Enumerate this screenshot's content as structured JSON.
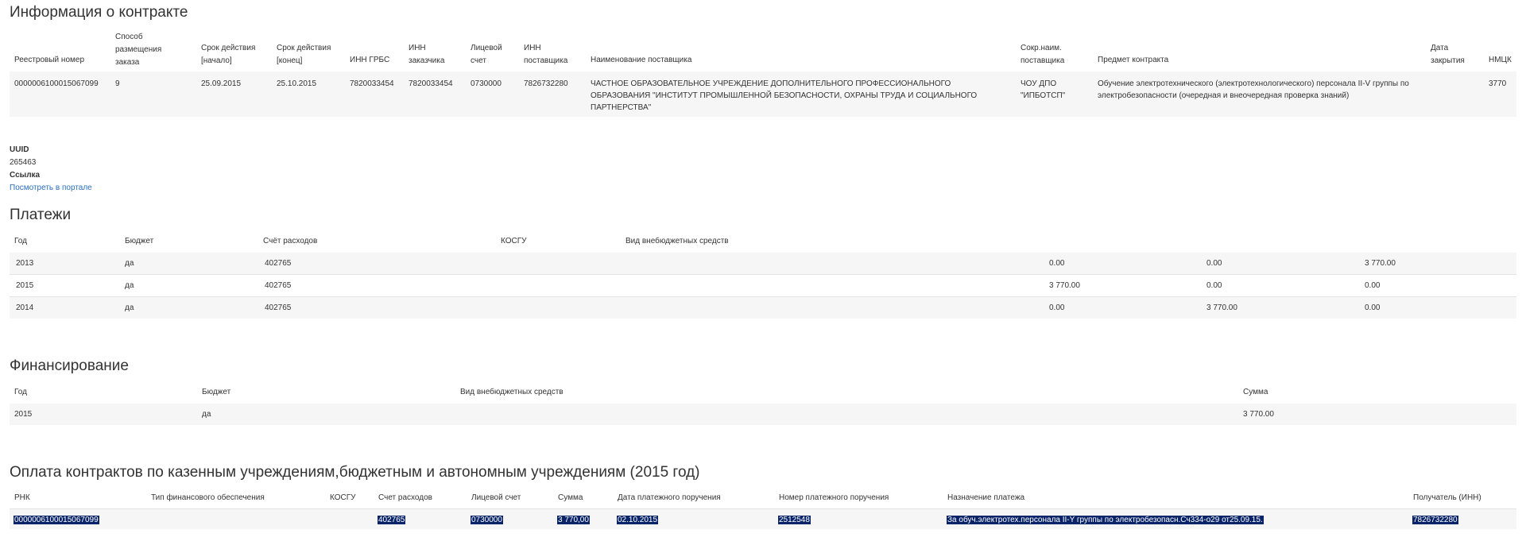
{
  "contract": {
    "title": "Информация о контракте",
    "headers": [
      "Реестровый номер",
      "Способ размещения заказа",
      "Срок действия [начало]",
      "Срок действия [конец]",
      "ИНН ГРБС",
      "ИНН заказчика",
      "Лицевой счет",
      "ИНН поставщика",
      "Наименование поставщика",
      "Сокр.наим. поставщика",
      "Предмет контракта",
      "Дата закрытия",
      "НМЦК"
    ],
    "row": [
      "0000006100015067099",
      "9",
      "25.09.2015",
      "25.10.2015",
      "7820033454",
      "7820033454",
      "0730000",
      "7826732280",
      "ЧАСТНОЕ ОБРАЗОВАТЕЛЬНОЕ УЧРЕЖДЕНИЕ ДОПОЛНИТЕЛЬНОГО ПРОФЕССИОНАЛЬНОГО ОБРАЗОВАНИЯ \"ИНСТИТУТ ПРОМЫШЛЕННОЙ БЕЗОПАСНОСТИ, ОХРАНЫ ТРУДА И СОЦИАЛЬНОГО ПАРТНЕРСТВА\"",
      "ЧОУ ДПО \"ИПБОТСП\"",
      "Обучение электротехнического (электротехнологического) персонала II-V группы по электробезопасности (очередная и внеочередная проверка знаний)",
      "",
      "3770"
    ]
  },
  "meta": {
    "uuid_label": "UUID",
    "uuid_value": "265463",
    "link_label": "Ссылка",
    "link_text": "Посмотреть в портале"
  },
  "payments": {
    "title": "Платежи",
    "headers": [
      "Год",
      "Бюджет",
      "Счёт расходов",
      "КОСГУ",
      "Вид внебюджетных средств"
    ],
    "rows": [
      [
        "2013",
        "да",
        "402765",
        "",
        "",
        "0.00",
        "0.00",
        "3 770.00"
      ],
      [
        "2015",
        "да",
        "402765",
        "",
        "",
        "3 770.00",
        "0.00",
        "0.00"
      ],
      [
        "2014",
        "да",
        "402765",
        "",
        "",
        "0.00",
        "3 770.00",
        "0.00"
      ]
    ]
  },
  "financing": {
    "title": "Финансирование",
    "headers": [
      "Год",
      "Бюджет",
      "Вид внебюджетных средств",
      "Сумма"
    ],
    "row": [
      "2015",
      "да",
      "",
      "3 770.00"
    ]
  },
  "contract_payments": {
    "title": "Оплата контрактов по казенным учреждениям,бюджетным и автономным учреждениям (2015 год)",
    "headers": [
      "РНК",
      "Тип финансового обеспечения",
      "КОСГУ",
      "Счет расходов",
      "Лицевой счет",
      "Сумма",
      "Дата платежного поручения",
      "Номер платежного поручения",
      "Назначение платежа",
      "Получатель (ИНН)"
    ],
    "row": [
      "0000006100015067099",
      "",
      "",
      "402765",
      "0730000",
      "3 770,00",
      "02.10.2015",
      "2512548",
      "За обуч.электротех.персонала II-Y группы по электробезопасн.Сч334-о29 от25.09.15.",
      "7826732280"
    ]
  },
  "colors": {
    "band": "#f6f6f6",
    "link": "#2a6ebb",
    "selection": "#0a246a"
  }
}
